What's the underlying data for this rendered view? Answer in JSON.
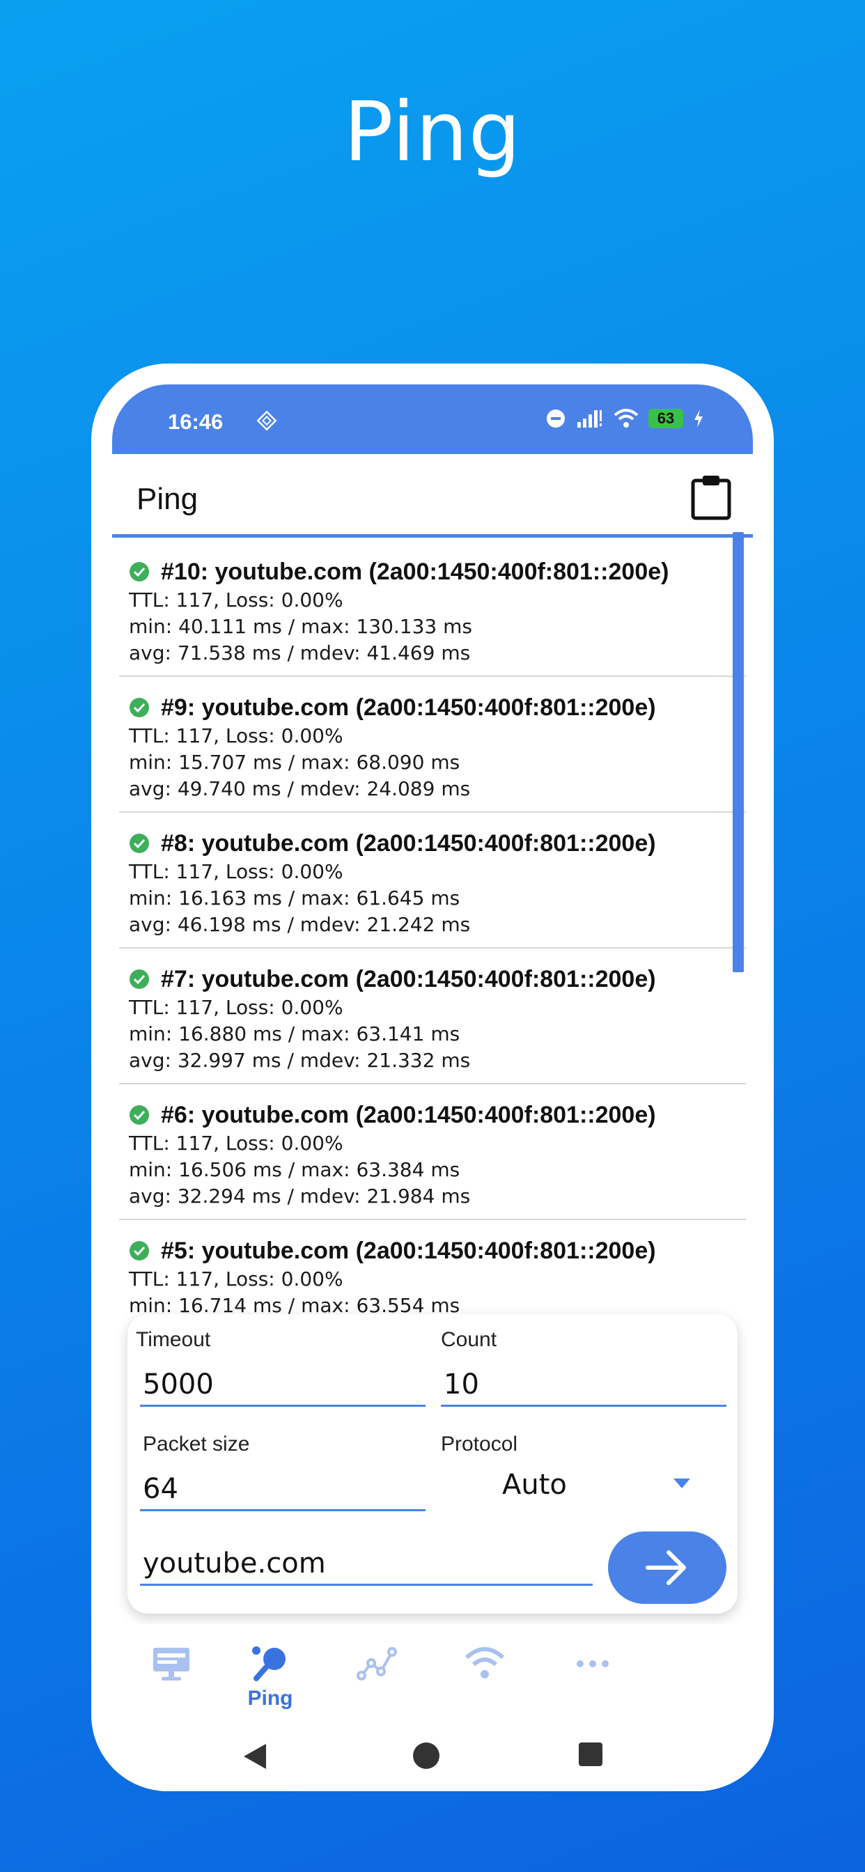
{
  "promo": {
    "title": "Ping"
  },
  "status_bar": {
    "time": "16:46",
    "battery": "63"
  },
  "header": {
    "title": "Ping"
  },
  "results": [
    {
      "title": "#10: youtube.com (2a00:1450:400f:801::200e)",
      "line1": "TTL: 117, Loss: 0.00%",
      "line2": "min: 40.111 ms / max: 130.133 ms",
      "line3": "avg: 71.538 ms / mdev: 41.469 ms"
    },
    {
      "title": "#9: youtube.com (2a00:1450:400f:801::200e)",
      "line1": "TTL: 117, Loss: 0.00%",
      "line2": "min: 15.707 ms / max: 68.090 ms",
      "line3": "avg: 49.740 ms / mdev: 24.089 ms"
    },
    {
      "title": "#8: youtube.com (2a00:1450:400f:801::200e)",
      "line1": "TTL: 117, Loss: 0.00%",
      "line2": "min: 16.163 ms / max: 61.645 ms",
      "line3": "avg: 46.198 ms / mdev: 21.242 ms"
    },
    {
      "title": "#7: youtube.com (2a00:1450:400f:801::200e)",
      "line1": "TTL: 117, Loss: 0.00%",
      "line2": "min: 16.880 ms / max: 63.141 ms",
      "line3": "avg: 32.997 ms / mdev: 21.332 ms"
    },
    {
      "title": "#6: youtube.com (2a00:1450:400f:801::200e)",
      "line1": "TTL: 117, Loss: 0.00%",
      "line2": "min: 16.506 ms / max: 63.384 ms",
      "line3": "avg: 32.294 ms / mdev: 21.984 ms"
    },
    {
      "title": "#5: youtube.com (2a00:1450:400f:801::200e)",
      "line1": "TTL: 117, Loss: 0.00%",
      "line2": "min: 16.714 ms / max: 63.554 ms",
      "line3": ""
    }
  ],
  "form": {
    "timeout_label": "Timeout",
    "timeout_value": "5000",
    "count_label": "Count",
    "count_value": "10",
    "packet_size_label": "Packet size",
    "packet_size_value": "64",
    "protocol_label": "Protocol",
    "protocol_value": "Auto",
    "host_value": "youtube.com"
  },
  "nav": {
    "ping_label": "Ping"
  },
  "colors": {
    "accent": "#4b82e8",
    "success": "#3fae5a"
  }
}
